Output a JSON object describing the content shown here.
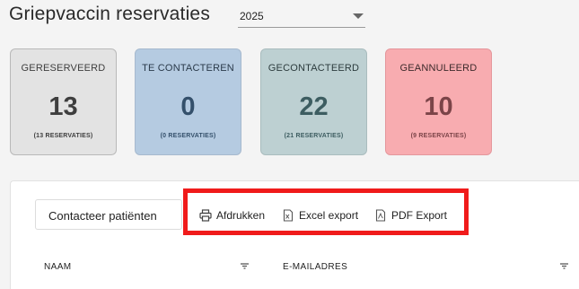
{
  "page": {
    "title": "Griepvaccin reservaties"
  },
  "year_select": {
    "value": "2025"
  },
  "cards": [
    {
      "label": "GERESERVEERD",
      "count": "13",
      "sub": "(13 RESERVATIES)"
    },
    {
      "label": "TE CONTACTEREN",
      "count": "0",
      "sub": "(0 RESERVATIES)"
    },
    {
      "label": "GECONTACTEERD",
      "count": "22",
      "sub": "(21 RESERVATIES)"
    },
    {
      "label": "GEANNULEERD",
      "count": "10",
      "sub": "(9 RESERVATIES)"
    }
  ],
  "toolbar": {
    "contact_label": "Contacteer patiënten",
    "print_label": "Afdrukken",
    "excel_label": "Excel export",
    "pdf_label": "PDF Export"
  },
  "table": {
    "columns": [
      "NAAM",
      "E-MAILADRES"
    ]
  },
  "colors": {
    "gereserveerd": "#e3e3e3",
    "te_contacteren": "#b5cbe1",
    "gecontacteerd": "#bdd0d2",
    "geannuleerd": "#f8acb0",
    "highlight": "#f01b1b"
  },
  "icons": [
    "printer-icon",
    "excel-file-icon",
    "pdf-file-icon",
    "filter-icon",
    "chevron-down-icon"
  ]
}
